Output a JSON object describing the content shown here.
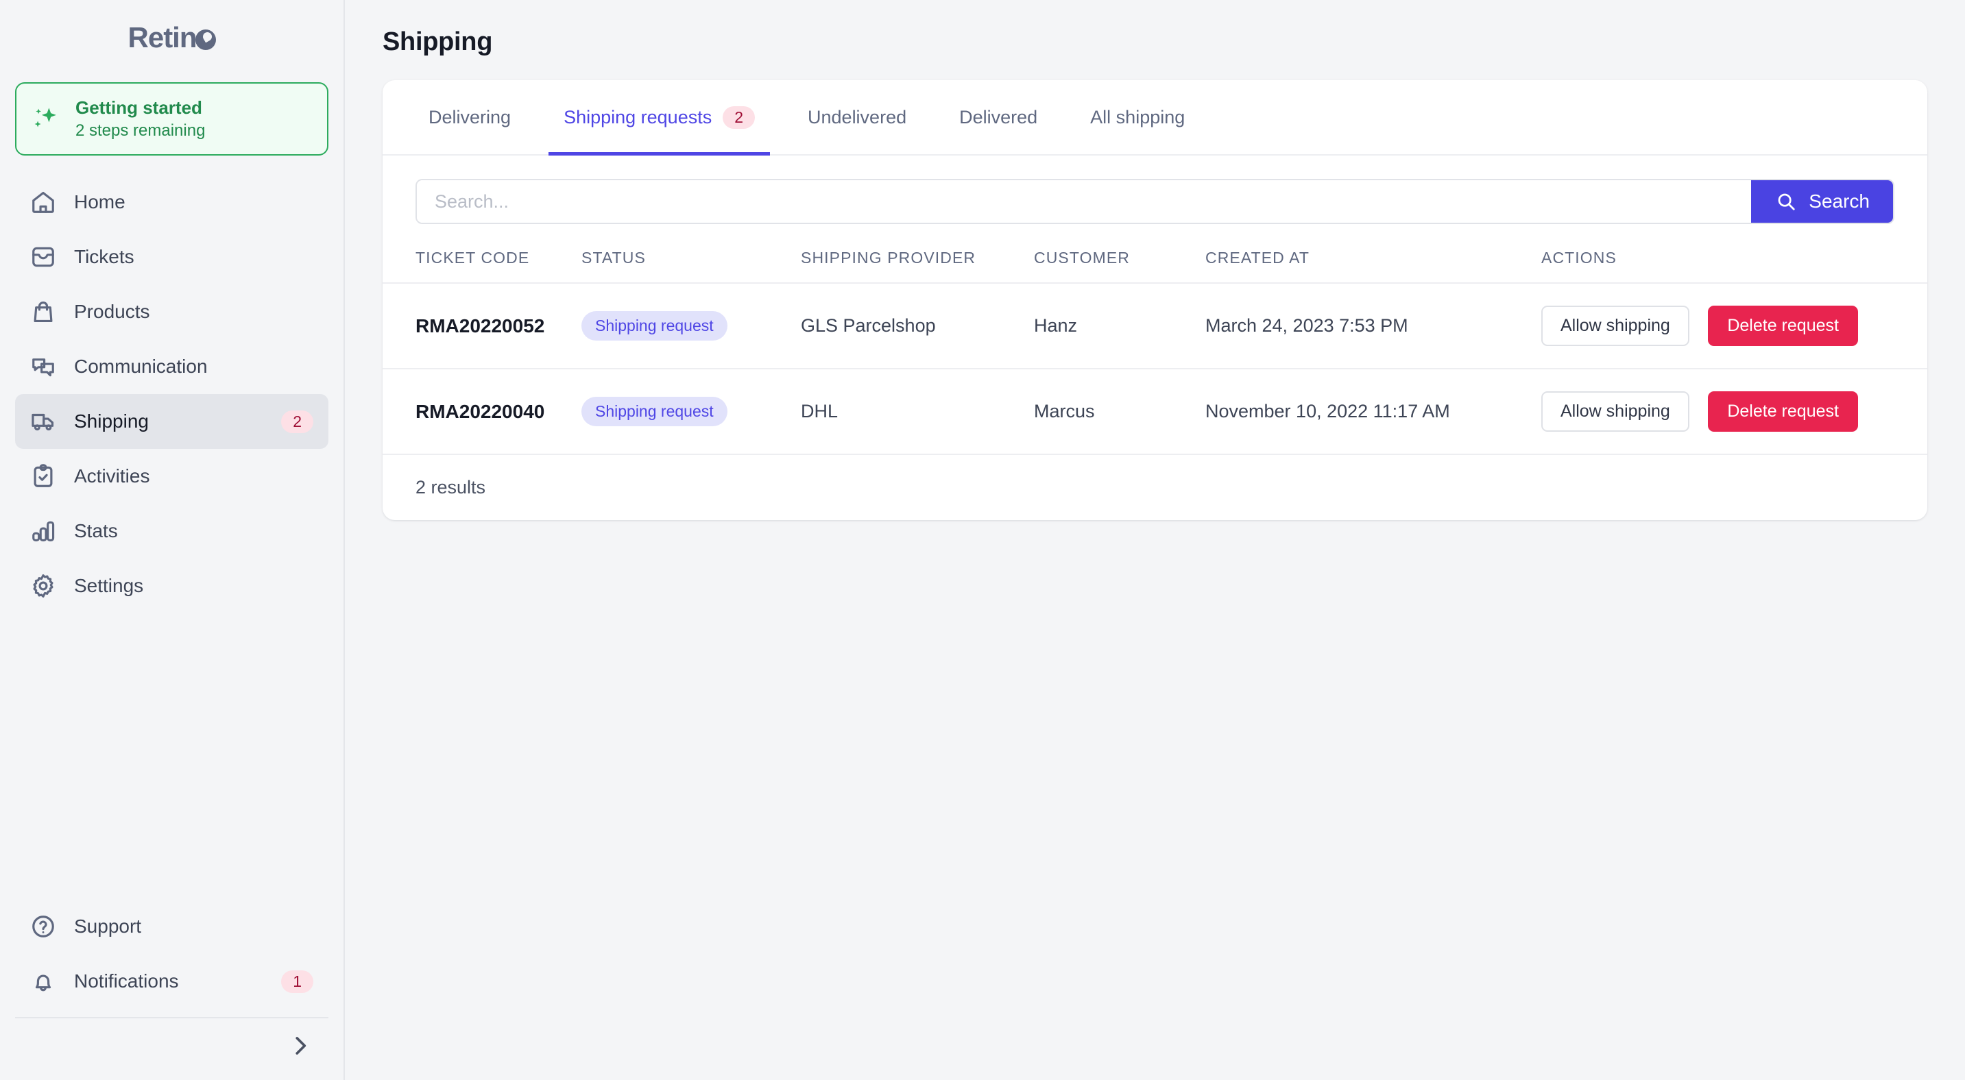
{
  "brand": {
    "name": "Retino"
  },
  "getting_started": {
    "title": "Getting started",
    "subtitle": "2 steps remaining",
    "icon": "sparkle-icon",
    "accent": "#2cab5d"
  },
  "sidebar": {
    "items": [
      {
        "label": "Home",
        "icon": "home-icon",
        "badge": null,
        "active": false
      },
      {
        "label": "Tickets",
        "icon": "inbox-icon",
        "badge": null,
        "active": false
      },
      {
        "label": "Products",
        "icon": "shopping-bag-icon",
        "badge": null,
        "active": false
      },
      {
        "label": "Communication",
        "icon": "chat-bubbles-icon",
        "badge": null,
        "active": false
      },
      {
        "label": "Shipping",
        "icon": "truck-icon",
        "badge": "2",
        "active": true
      },
      {
        "label": "Activities",
        "icon": "clipboard-check-icon",
        "badge": null,
        "active": false
      },
      {
        "label": "Stats",
        "icon": "bar-chart-icon",
        "badge": null,
        "active": false
      },
      {
        "label": "Settings",
        "icon": "gear-icon",
        "badge": null,
        "active": false
      }
    ],
    "bottom_items": [
      {
        "label": "Support",
        "icon": "help-circle-icon",
        "badge": null
      },
      {
        "label": "Notifications",
        "icon": "bell-icon",
        "badge": "1"
      }
    ],
    "collapse_icon": "chevron-right-icon"
  },
  "header": {
    "title": "Shipping"
  },
  "tabs": [
    {
      "label": "Delivering",
      "badge": null,
      "active": false
    },
    {
      "label": "Shipping requests",
      "badge": "2",
      "active": true
    },
    {
      "label": "Undelivered",
      "badge": null,
      "active": false
    },
    {
      "label": "Delivered",
      "badge": null,
      "active": false
    },
    {
      "label": "All shipping",
      "badge": null,
      "active": false
    }
  ],
  "search": {
    "placeholder": "Search...",
    "value": "",
    "button_label": "Search",
    "button_icon": "search-icon",
    "button_color": "#4a43e2"
  },
  "table": {
    "columns": [
      "TICKET CODE",
      "STATUS",
      "SHIPPING PROVIDER",
      "CUSTOMER",
      "CREATED AT",
      "ACTIONS"
    ],
    "rows": [
      {
        "ticket_code": "RMA20220052",
        "status": "Shipping request",
        "provider": "GLS Parcelshop",
        "customer": "Hanz",
        "created_at": "March 24, 2023 7:53 PM",
        "allow_label": "Allow shipping",
        "delete_label": "Delete request"
      },
      {
        "ticket_code": "RMA20220040",
        "status": "Shipping request",
        "provider": "DHL",
        "customer": "Marcus",
        "created_at": "November 10, 2022 11:17 AM",
        "allow_label": "Allow shipping",
        "delete_label": "Delete request"
      }
    ],
    "footer": "2 results"
  },
  "colors": {
    "accent": "#4f46e5",
    "danger": "#e8244f",
    "success": "#2cab5d",
    "badge_bg": "#fde0e6",
    "badge_text": "#9f0f35"
  }
}
